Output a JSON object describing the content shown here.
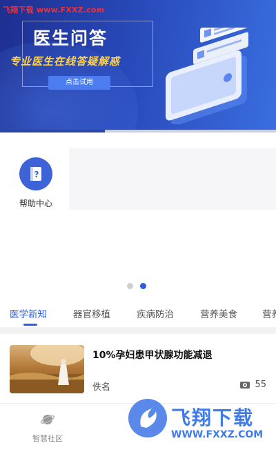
{
  "banner": {
    "watermark": "飞翔下载 www.FXXZ.com",
    "title": "医生问答",
    "subtitle": "专业医生在线答疑解惑",
    "try_button": "点击试用",
    "progress": 0.38,
    "colors": {
      "bg_start": "#1d2f8f",
      "bg_end": "#3a6ee0",
      "subtitle": "#ffd24a"
    }
  },
  "quick_entries": [
    {
      "label": "帮助中心",
      "icon": "help-book-icon"
    }
  ],
  "pager": {
    "count": 2,
    "active_index": 1
  },
  "tabs": [
    {
      "label": "医学新知",
      "active": true
    },
    {
      "label": "器官移植",
      "active": false
    },
    {
      "label": "疾病防治",
      "active": false
    },
    {
      "label": "营养美食",
      "active": false
    },
    {
      "label": "营养",
      "active": false
    }
  ],
  "articles": [
    {
      "title": "10%孕妇患甲状腺功能减退",
      "author": "佚名",
      "views": "55",
      "views_icon": "eye-icon"
    }
  ],
  "bottom_nav": [
    {
      "label": "智慧社区",
      "icon": "planet-icon"
    }
  ],
  "footer_watermark": {
    "name": "飞翔下载",
    "url": "WWW.FXXZ.COM"
  },
  "accent_color": "#2f5de0"
}
